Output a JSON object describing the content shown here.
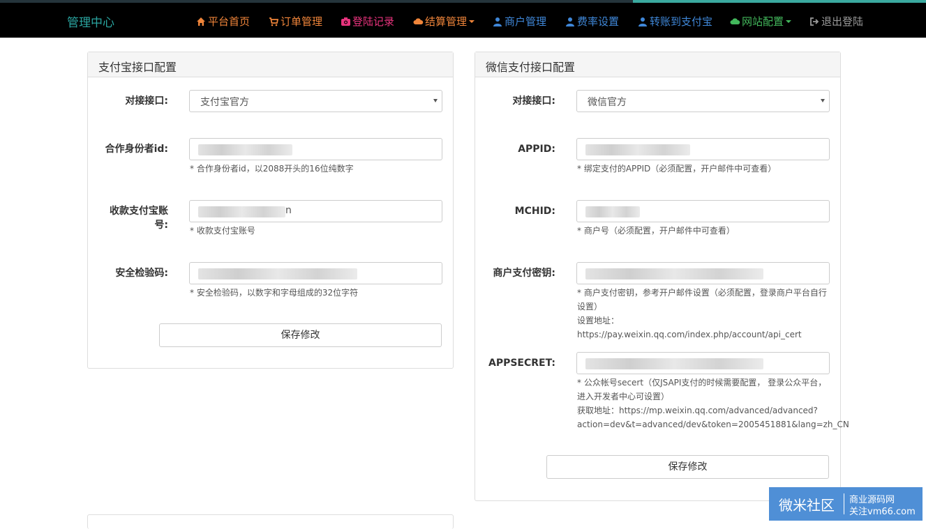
{
  "nav": {
    "brand": "管理中心",
    "items": [
      {
        "label": "平台首页",
        "icon": "home-icon",
        "color": "#f0853a"
      },
      {
        "label": "订单管理",
        "icon": "cart-icon",
        "color": "#f0853a"
      },
      {
        "label": "登陆记录",
        "icon": "camera-icon",
        "color": "#e8337d"
      },
      {
        "label": "结算管理",
        "icon": "cloud-icon",
        "color": "#f0853a"
      },
      {
        "label": "商户管理",
        "icon": "user-icon",
        "color": "#3f87d8"
      },
      {
        "label": "费率设置",
        "icon": "user-icon",
        "color": "#3f87d8"
      },
      {
        "label": "转账到支付宝",
        "icon": "user-icon",
        "color": "#3f87d8"
      },
      {
        "label": "网站配置",
        "icon": "cloud-icon",
        "color": "#43b85c"
      },
      {
        "label": "退出登陆",
        "icon": "logout-icon",
        "color": "#9a9a9a"
      }
    ]
  },
  "alipay": {
    "title": "支付宝接口配置",
    "interface_label": "对接接口:",
    "interface_value": "支付宝官方",
    "partner_label": "合作身份者id:",
    "partner_help": "* 合作身份者id，以2088开头的16位纯数字",
    "account_label_line1": "收款支付宝账",
    "account_label_line2": "号:",
    "account_suffix": "n",
    "account_help": "* 收款支付宝账号",
    "key_label": "安全检验码:",
    "key_help": "* 安全检验码，以数字和字母组成的32位字符",
    "save": "保存修改"
  },
  "wechat": {
    "title": "微信支付接口配置",
    "interface_label": "对接接口:",
    "interface_value": "微信官方",
    "appid_label": "APPID:",
    "appid_help": "* 绑定支付的APPID（必须配置，开户邮件中可查看）",
    "mchid_label": "MCHID:",
    "mchid_help": "* 商户号（必须配置，开户邮件中可查看）",
    "key_label": "商户支付密钥:",
    "key_help_1": "* 商户支付密钥，参考开户邮件设置（必须配置，登录商户平台自行",
    "key_help_2": "设置）",
    "key_help_3": "设置地址：https://pay.weixin.qq.com/index.php/account/api_cert",
    "secret_label": "APPSECRET:",
    "secret_help_1": "* 公众帐号secert（仅JSAPI支付的时候需要配置， 登录公众平台，",
    "secret_help_2": "进入开发者中心可设置）",
    "secret_help_3": "获取地址：https://mp.weixin.qq.com/advanced/advanced?",
    "secret_help_4": "action=dev&t=advanced/dev&token=2005451881&lang=zh_CN",
    "save": "保存修改"
  },
  "watermark": {
    "main": "微米社区",
    "sub1": "商业源码网",
    "sub2": "关注vm66.com"
  }
}
